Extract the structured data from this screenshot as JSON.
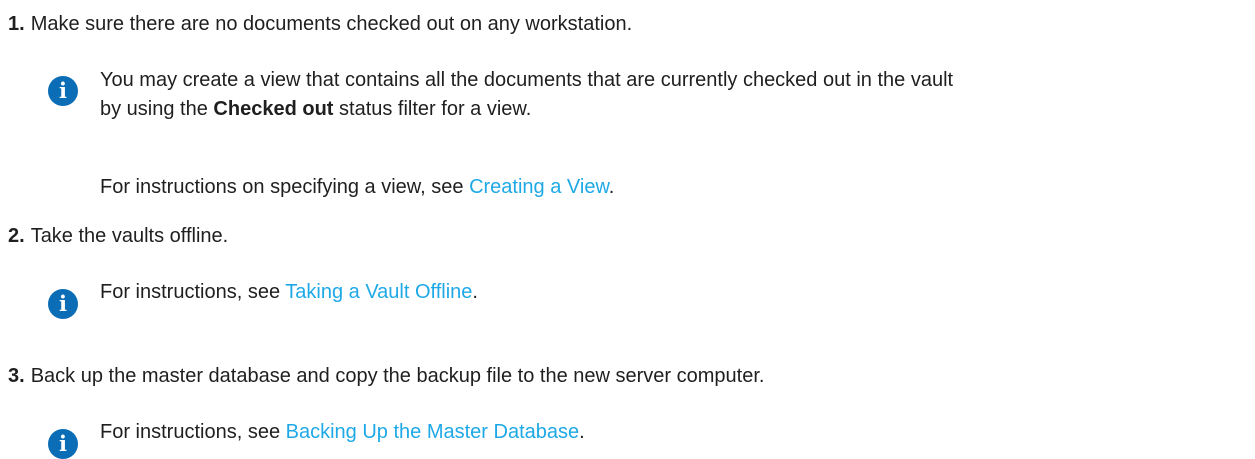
{
  "steps": [
    {
      "number": "1.",
      "text": "Make sure there are no documents checked out on any workstation.",
      "note": {
        "icon": "info-icon",
        "line1": "You may create a view that contains all the documents that are currently checked out in the vault",
        "line2_prefix": "by using the ",
        "line2_bold": "Checked out",
        "line2_suffix": " status filter for a view.",
        "followup_prefix": "For instructions on specifying a view, see ",
        "followup_link": "Creating a View",
        "followup_suffix": "."
      }
    },
    {
      "number": "2.",
      "text": "Take the vaults offline.",
      "note": {
        "icon": "info-icon",
        "prefix": "For instructions, see ",
        "link": "Taking a Vault Offline",
        "suffix": "."
      }
    },
    {
      "number": "3.",
      "text": "Back up the master database and copy the backup file to the new server computer.",
      "note": {
        "icon": "info-icon",
        "prefix": "For instructions, see ",
        "link": "Backing Up the Master Database",
        "suffix": "."
      }
    }
  ],
  "colors": {
    "text": "#1f1f1f",
    "link": "#1ea9e6",
    "info_icon": "#0a6db5"
  }
}
